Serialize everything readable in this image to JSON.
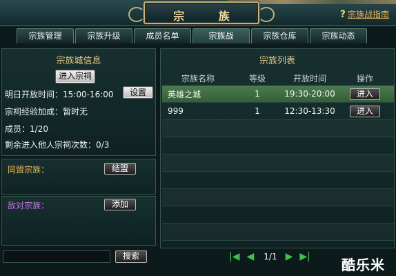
{
  "header": {
    "title": "宗 族",
    "guide_link": "宗族战指南",
    "guide_icon": "?"
  },
  "tabs": [
    {
      "label": "宗族管理"
    },
    {
      "label": "宗族升级"
    },
    {
      "label": "成员名单"
    },
    {
      "label": "宗族战",
      "active": true
    },
    {
      "label": "宗族仓库"
    },
    {
      "label": "宗族动态"
    }
  ],
  "city_info": {
    "title": "宗族城信息",
    "enter_button": "进入宗祠",
    "open_time_label": "明日开放时间：",
    "open_time_value": "15:00-16:00",
    "settings_button": "设置",
    "exp_bonus_label": "宗祠经验加成：",
    "exp_bonus_value": "暂时无",
    "members_label": "成员：",
    "members_value": "1/20",
    "remaining_label": "剩余进入他人宗祠次数：",
    "remaining_value": "0/3"
  },
  "alliance": {
    "ally_label": "同盟宗族：",
    "ally_button": "结盟",
    "enemy_label": "敌对宗族：",
    "enemy_button": "添加"
  },
  "search": {
    "button": "搜索",
    "value": ""
  },
  "clan_list": {
    "title": "宗族列表",
    "columns": [
      "宗族名称",
      "等级",
      "开放时间",
      "操作"
    ],
    "rows": [
      {
        "name": "英雄之城",
        "level": "1",
        "time": "19:30-20:00",
        "action": "进入"
      },
      {
        "name": "999",
        "level": "1",
        "time": "12:30-13:30",
        "action": "进入"
      }
    ]
  },
  "pager": {
    "page": "1/1",
    "first_icon": "first-page-icon",
    "prev_icon": "prev-page-icon",
    "next_icon": "next-page-icon",
    "last_icon": "last-page-icon"
  },
  "watermark": "酷乐米",
  "colors": {
    "accent_gold": "#e9c787",
    "ally_orange": "#f1b65c",
    "enemy_purple": "#c876ea",
    "selected_row": "#3f6c41",
    "pager_green": "#3fbf4b"
  }
}
